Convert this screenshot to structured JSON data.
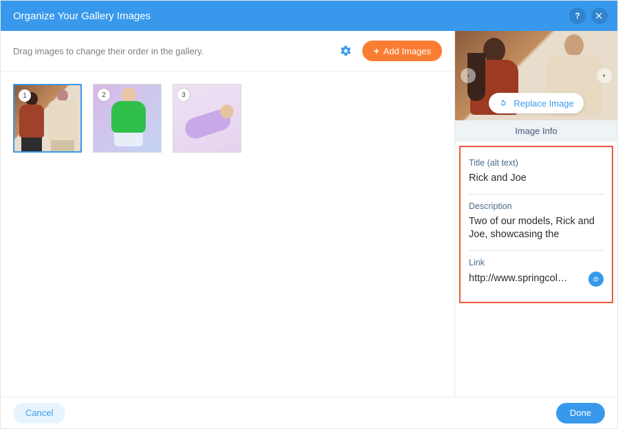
{
  "header": {
    "title": "Organize Your Gallery Images"
  },
  "toolbar": {
    "hint": "Drag images to change their order in the gallery.",
    "add_label": "Add Images"
  },
  "thumbs": [
    {
      "num": "1",
      "selected": true
    },
    {
      "num": "2",
      "selected": false
    },
    {
      "num": "3",
      "selected": false
    }
  ],
  "preview": {
    "replace_label": "Replace Image"
  },
  "info": {
    "header": "Image Info",
    "title_label": "Title (alt text)",
    "title_value": "Rick and Joe",
    "desc_label": "Description",
    "desc_value": "Two of our models, Rick and Joe, showcasing the",
    "link_label": "Link",
    "link_value": "http://www.springcol…"
  },
  "footer": {
    "cancel": "Cancel",
    "done": "Done"
  }
}
